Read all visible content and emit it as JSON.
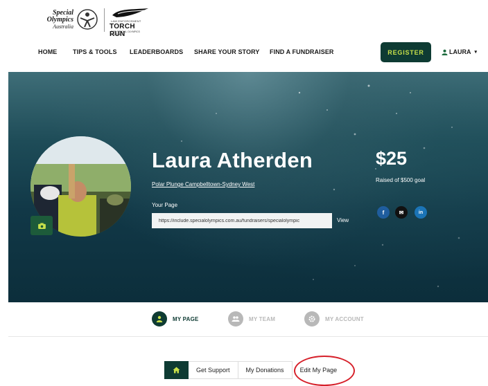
{
  "brand": {
    "so_line1": "Special",
    "so_line2": "Olympics",
    "so_line3": "Australia",
    "torch_small": "LAW ENFORCEMENT",
    "torch_big": "TORCH RUN",
    "torch_tiny": "FOR SPECIAL OLYMPICS AUSTRALIA"
  },
  "nav": {
    "items": [
      "HOME",
      "TIPS & TOOLS",
      "LEADERBOARDS",
      "SHARE YOUR STORY",
      "FIND A FUNDRAISER"
    ],
    "register": "REGISTER",
    "user": "LAURA"
  },
  "profile": {
    "name": "Laura Atherden",
    "event": "Polar Plunge Campbelltown-Sydney West",
    "your_page_label": "Your Page",
    "page_url": "https://include.specialolympics.com.au/fundraisers/specialolympic",
    "view": "View",
    "amount": "$25",
    "raised_text": "Raised of $500 goal"
  },
  "social": [
    {
      "icon": "facebook-icon",
      "glyph": "f",
      "color": "#1f5d9e"
    },
    {
      "icon": "email-icon",
      "glyph": "✉",
      "color": "#111111"
    },
    {
      "icon": "linkedin-icon",
      "glyph": "in",
      "color": "#1b74b6"
    }
  ],
  "tabs": [
    {
      "label": "MY PAGE",
      "active": true
    },
    {
      "label": "MY TEAM",
      "active": false
    },
    {
      "label": "MY ACCOUNT",
      "active": false
    }
  ],
  "subnav": {
    "items": [
      "Get Support",
      "My Donations",
      "Edit My Page"
    ]
  },
  "colors": {
    "brand_dark": "#0e3b33",
    "brand_accent": "#c8e04a",
    "inactive": "#b8b8b8",
    "highlight": "#d6202a"
  }
}
